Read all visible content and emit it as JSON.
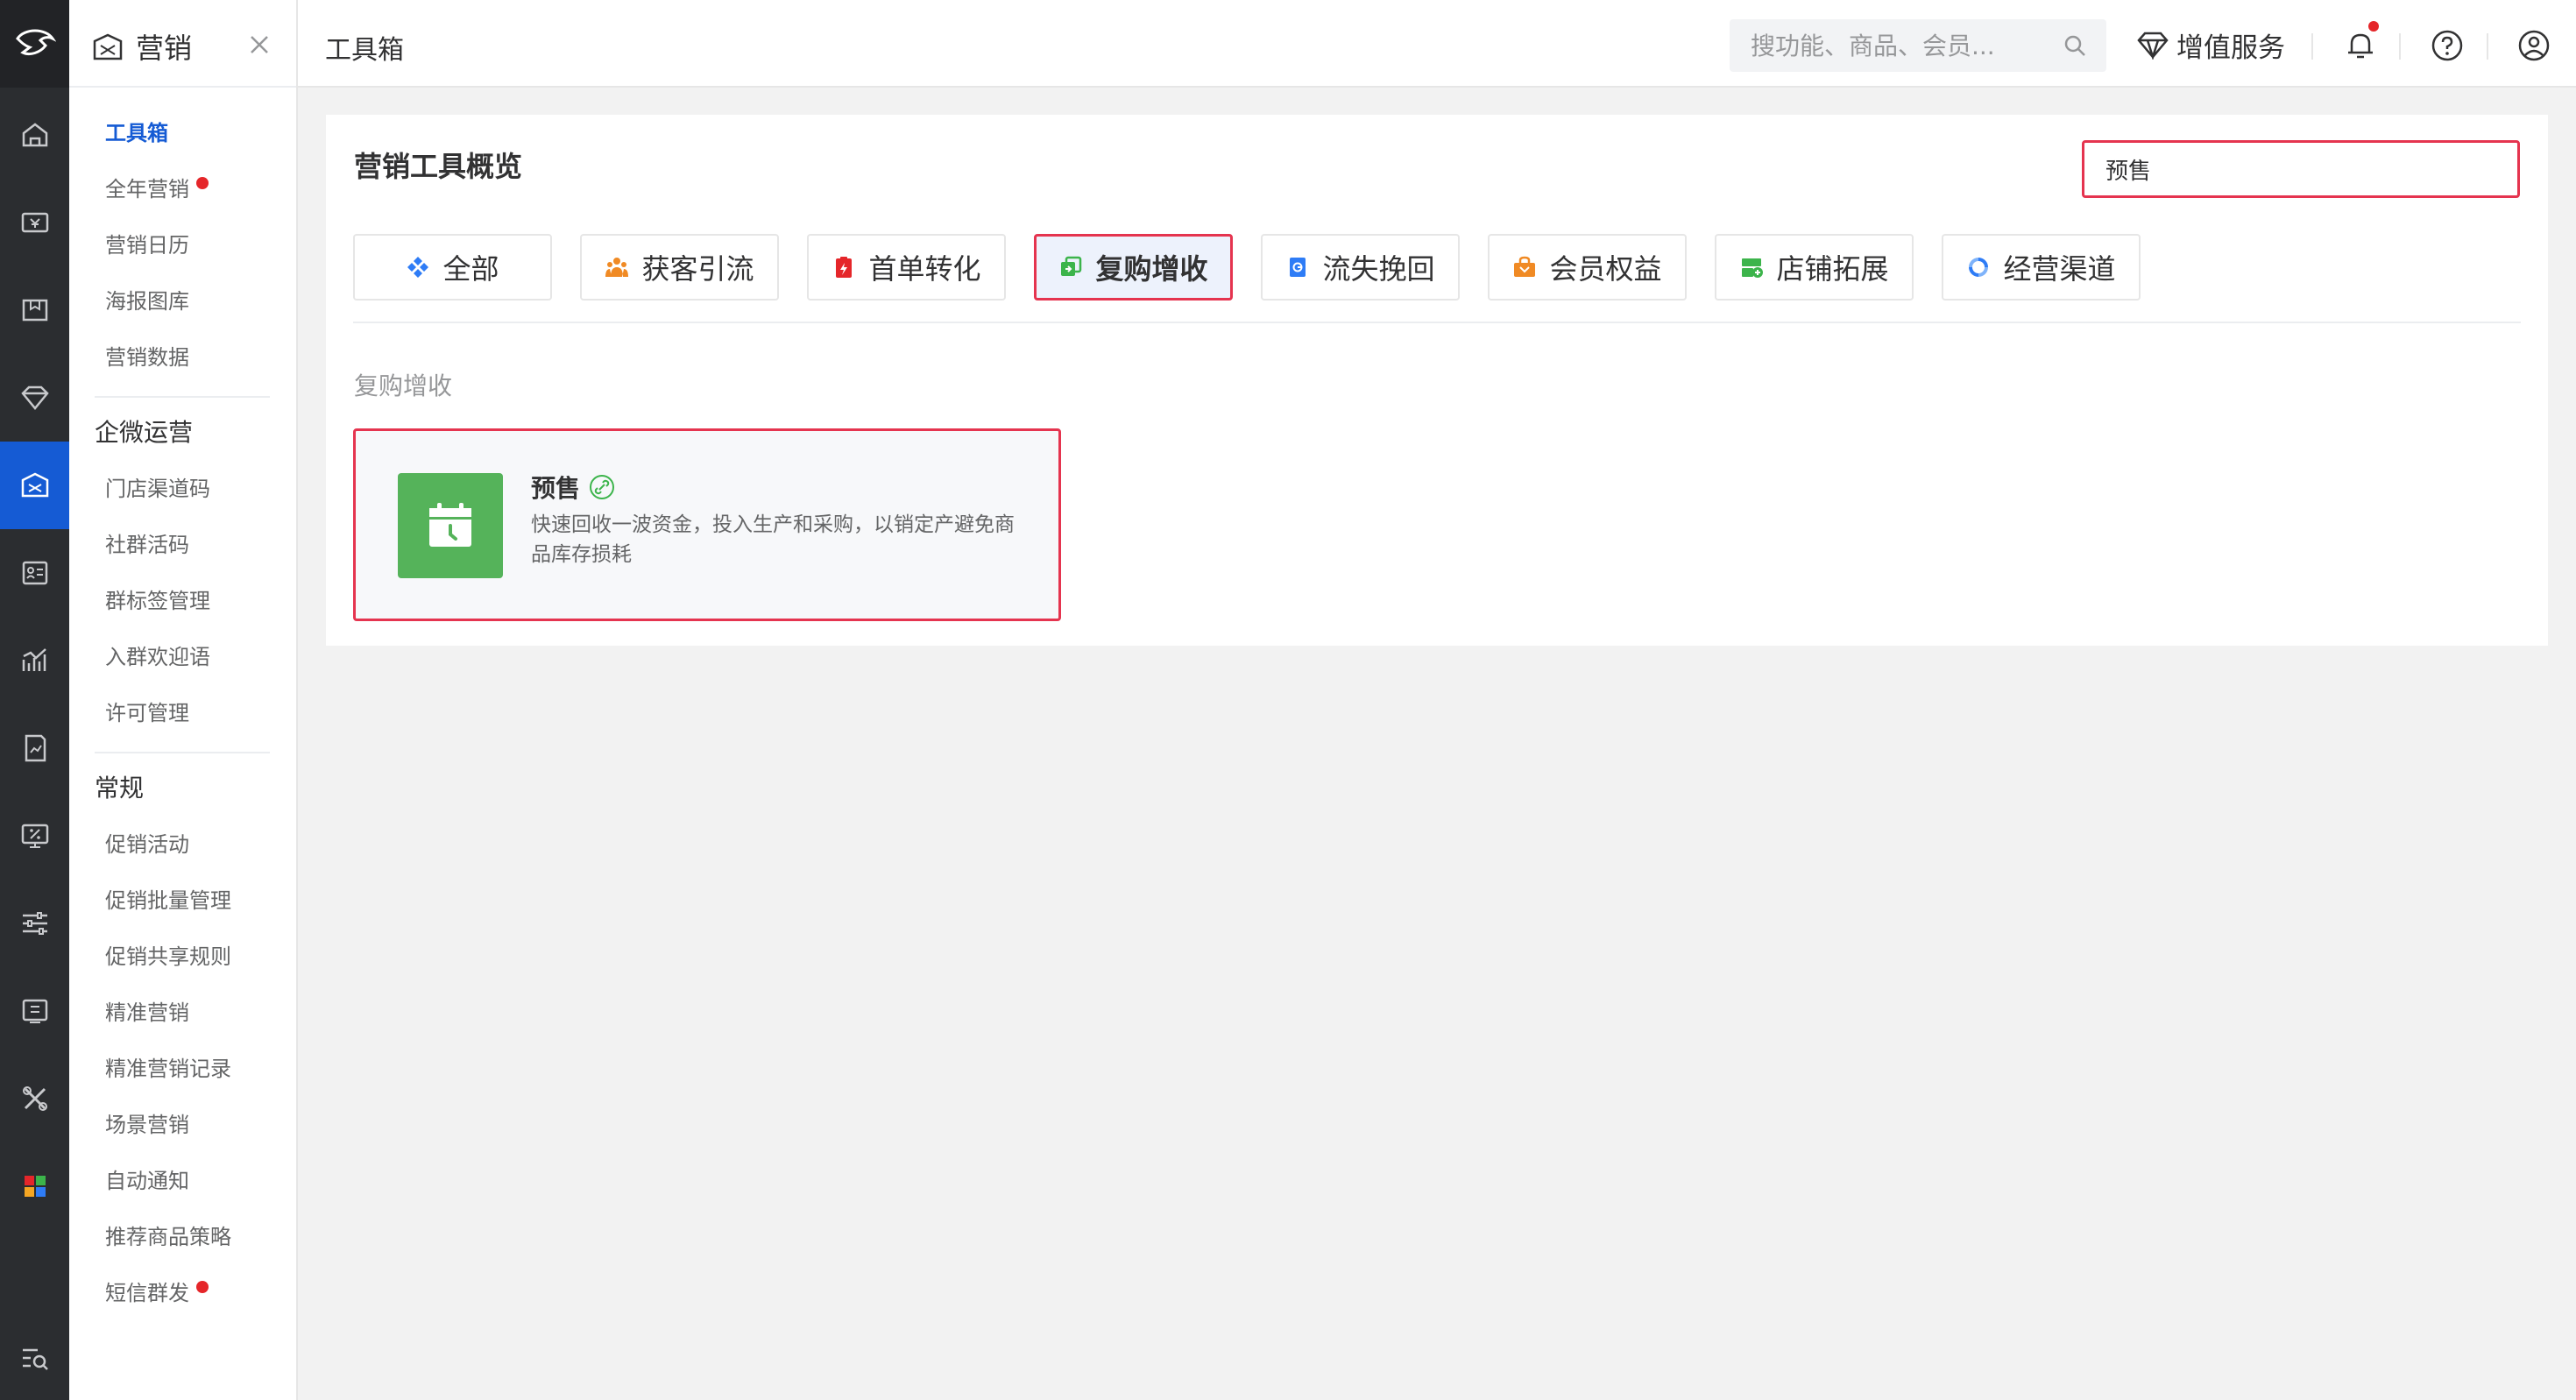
{
  "subnav": {
    "title": "营销",
    "items_top": [
      {
        "label": "工具箱",
        "active": true,
        "dot": false
      },
      {
        "label": "全年营销",
        "active": false,
        "dot": true
      },
      {
        "label": "营销日历",
        "active": false,
        "dot": false
      },
      {
        "label": "海报图库",
        "active": false,
        "dot": false
      },
      {
        "label": "营销数据",
        "active": false,
        "dot": false
      }
    ],
    "group_qiwei": {
      "title": "企微运营",
      "items": [
        "门店渠道码",
        "社群活码",
        "群标签管理",
        "入群欢迎语",
        "许可管理"
      ]
    },
    "group_regular": {
      "title": "常规",
      "items": [
        {
          "label": "促销活动",
          "dot": false
        },
        {
          "label": "促销批量管理",
          "dot": false
        },
        {
          "label": "促销共享规则",
          "dot": false
        },
        {
          "label": "精准营销",
          "dot": false
        },
        {
          "label": "精准营销记录",
          "dot": false
        },
        {
          "label": "场景营销",
          "dot": false
        },
        {
          "label": "自动通知",
          "dot": false
        },
        {
          "label": "推荐商品策略",
          "dot": false
        },
        {
          "label": "短信群发",
          "dot": true
        }
      ]
    }
  },
  "topbar": {
    "breadcrumb": "工具箱",
    "search_placeholder": "搜功能、商品、会员...",
    "vas_label": "增值服务"
  },
  "panel": {
    "title": "营销工具概览",
    "tool_search_value": "预售",
    "categories": [
      {
        "label": "全部",
        "icon": "diamond-grid-icon",
        "color": "#2e7cf6",
        "active": false
      },
      {
        "label": "获客引流",
        "icon": "people-icon",
        "color": "#f08a24",
        "active": false
      },
      {
        "label": "首单转化",
        "icon": "lightning-clipboard-icon",
        "color": "#e5262a",
        "active": false
      },
      {
        "label": "复购增收",
        "icon": "repeat-square-icon",
        "color": "#3cb44b",
        "active": true
      },
      {
        "label": "流失挽回",
        "icon": "document-g-icon",
        "color": "#2e7cf6",
        "active": false
      },
      {
        "label": "会员权益",
        "icon": "gift-bag-icon",
        "color": "#f08a24",
        "active": false
      },
      {
        "label": "店铺拓展",
        "icon": "store-plus-icon",
        "color": "#3cb44b",
        "active": false
      },
      {
        "label": "经营渠道",
        "icon": "cycle-icon",
        "color": "#2e7cf6",
        "active": false
      }
    ],
    "section_label": "复购增收",
    "tool_card": {
      "name": "预售",
      "description": "快速回收一波资金，投入生产和采购，以销定产避免商品库存损耗",
      "icon": "calendar-clock-icon",
      "icon_bg": "#55b35a"
    }
  }
}
